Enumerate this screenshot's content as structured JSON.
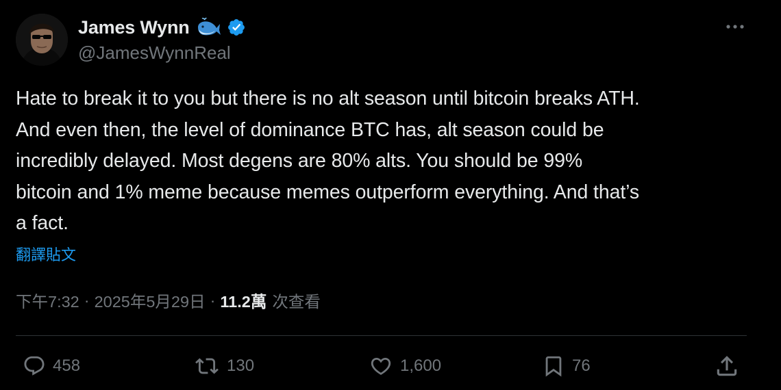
{
  "author": {
    "display_name": "James Wynn",
    "handle": "@JamesWynnReal",
    "verified": true,
    "name_emoji_icon": "whale-icon",
    "verified_icon": "verified-badge-icon"
  },
  "tweet": {
    "text": "Hate to break it to you but there is no alt season until bitcoin breaks ATH.\nAnd even then, the level of dominance BTC has, alt season could be\nincredibly delayed. Most degens are 80% alts. You should be 99%\nbitcoin and 1% meme because memes outperform everything. And that’s\na fact.",
    "translate_label": "翻譯貼文"
  },
  "meta": {
    "time": "下午7:32",
    "separator": "·",
    "date": "2025年5月29日",
    "views_count": "11.2萬",
    "views_label": "次查看"
  },
  "actions": {
    "replies": "458",
    "reposts": "130",
    "likes": "1,600",
    "bookmarks": "76"
  },
  "colors": {
    "background": "#000000",
    "text_primary": "#e7e9ea",
    "text_secondary": "#71767b",
    "link": "#1d9bf0",
    "divider": "#2f3336"
  }
}
